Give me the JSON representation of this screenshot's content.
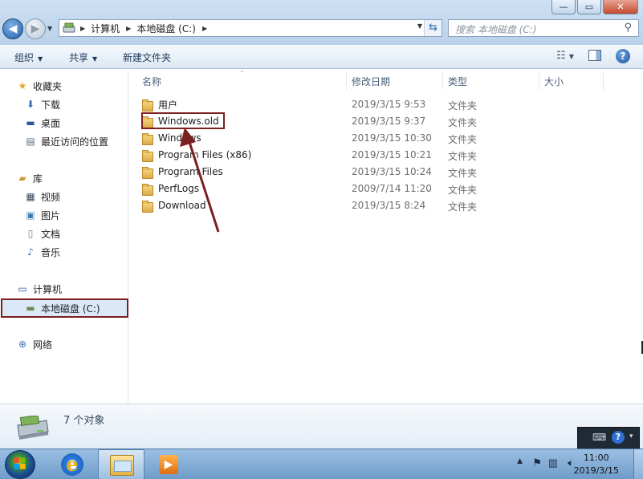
{
  "window": {
    "minimize_glyph": "—",
    "maximize_glyph": "▭",
    "close_glyph": "✕"
  },
  "address": {
    "crumbs": [
      "计算机",
      "本地磁盘 (C:)"
    ],
    "search_placeholder": "搜索 本地磁盘 (C:)"
  },
  "toolbar": {
    "organize": "组织",
    "share": "共享",
    "new_folder": "新建文件夹"
  },
  "sidebar": {
    "favorites": "收藏夹",
    "downloads": "下载",
    "desktop": "桌面",
    "recent": "最近访问的位置",
    "libraries": "库",
    "videos": "视频",
    "pictures": "图片",
    "documents": "文档",
    "music": "音乐",
    "computer": "计算机",
    "local_disk": "本地磁盘 (C:)",
    "network": "网络"
  },
  "columns": {
    "name": "名称",
    "modified": "修改日期",
    "type": "类型",
    "size": "大小"
  },
  "files": [
    {
      "name": "用户",
      "modified": "2019/3/15 9:53",
      "type": "文件夹"
    },
    {
      "name": "Windows.old",
      "modified": "2019/3/15 9:37",
      "type": "文件夹"
    },
    {
      "name": "Windows",
      "modified": "2019/3/15 10:30",
      "type": "文件夹"
    },
    {
      "name": "Program Files (x86)",
      "modified": "2019/3/15 10:21",
      "type": "文件夹"
    },
    {
      "name": "Program Files",
      "modified": "2019/3/15 10:24",
      "type": "文件夹"
    },
    {
      "name": "PerfLogs",
      "modified": "2009/7/14 11:20",
      "type": "文件夹"
    },
    {
      "name": "Download",
      "modified": "2019/3/15 8:24",
      "type": "文件夹"
    }
  ],
  "details": {
    "count": "7 个对象"
  },
  "taskbar": {
    "time": "11:00",
    "date": "2019/3/15"
  },
  "colors": {
    "annotation": "#7c1f1f",
    "toolbar_text": "#1e395b"
  }
}
